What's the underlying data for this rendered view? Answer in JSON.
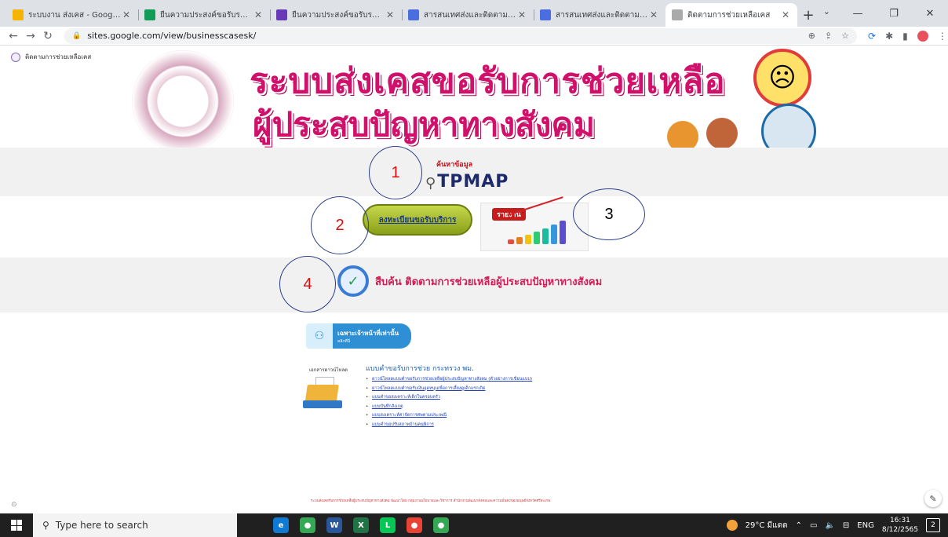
{
  "browser": {
    "tabs": [
      {
        "title": "ระบบงาน ส่งเคส - Google ไดรฟ์",
        "favicon_color": "#f4b400",
        "active": false
      },
      {
        "title": "ยืนความประสงค์ขอรับรหัสเข้าใช้ง",
        "favicon_color": "#0f9d58",
        "active": false
      },
      {
        "title": "ยืนความประสงค์ขอรับรหัสเข้าใช้ง",
        "favicon_color": "#673ab7",
        "active": false
      },
      {
        "title": "สารสนเทศส่งและติดตามเคส",
        "favicon_color": "#4a6ee0",
        "active": false
      },
      {
        "title": "สารสนเทศส่งและติดตามเคส",
        "favicon_color": "#4a6ee0",
        "active": false
      },
      {
        "title": "ติดตามการช่วยเหลือเคส",
        "favicon_color": "#aaaaaa",
        "active": true
      }
    ],
    "new_tab_icon": "+",
    "url": "sites.google.com/view/businesscasesk/"
  },
  "page": {
    "site_name": "ติดตามการช่วยเหลือเคส",
    "banner_line1": "ระบบส่งเคสขอรับการช่วยเหลือ",
    "banner_line2": "ผู้ประสบปัญหาทางสังคม",
    "tpmap_caption": "ค้นหาข้อมูล",
    "tpmap_logo": "TPMAP",
    "register_button": "ลงทะเบียนขอรับบริการ",
    "report_label": "รายงาน",
    "track_link": "สืบค้น ติดตามการช่วยเหลือผู้ประสบปัญหาทางสังคม",
    "staff_only_title": "เฉพาะเจ้าหน้าที่เท่านั้น",
    "staff_only_sub": "คลิกที่นี่",
    "docs_label": "เอกสารดาวน์โหลด",
    "forms_title": "แบบคำขอรับการช่วย กระทรวง พม.",
    "forms": [
      "ดาวน์โหลดแบบคำขอรับการช่วยเหลือผู้ประสบปัญหาทางสังคม (ตัวอย่างการเขียนแบบ)",
      "ดาวน์โหลดแบบคำขอรับเงินอุดหนุนเพื่อการเลี้ยงดูเด็กแรกเกิด",
      "แบบคำขอสงเคราะห์เด็กในครอบครัว",
      "แบบบันทึกสังเกตุ",
      "แบบสงเคราะห์ค่าจัดการศพตามประเพณี",
      "แบบคำขอปรับสภาพบ้านคนพิการ"
    ],
    "footer_note": "ระบบส่งเคสรับการช่วยเหลือผู้ประสบปัญหาทางสังคม พัฒนาโดย กลุ่มงานนโยบายและวิชาการ สำนักงานพัฒนาสังคมและความมั่นคงของมนุษย์จังหวัดศรีสะเกษ",
    "annotations": [
      "1",
      "2",
      "3",
      "4"
    ]
  },
  "taskbar": {
    "search_placeholder": "Type here to search",
    "apps": [
      {
        "name": "edge",
        "color": "#0f7ad4",
        "glyph": "e"
      },
      {
        "name": "chrome",
        "color": "#34a853",
        "glyph": "●"
      },
      {
        "name": "word",
        "color": "#2b579a",
        "glyph": "W"
      },
      {
        "name": "excel",
        "color": "#217346",
        "glyph": "X"
      },
      {
        "name": "line",
        "color": "#06c755",
        "glyph": "L"
      },
      {
        "name": "chrome-profile-2",
        "color": "#ea4335",
        "glyph": "●"
      },
      {
        "name": "chrome-profile-3",
        "color": "#34a853",
        "glyph": "●"
      }
    ],
    "weather": "29°C มีแดด",
    "lang": "ENG",
    "time": "16:31",
    "date": "8/12/2565",
    "notifications": "2"
  }
}
